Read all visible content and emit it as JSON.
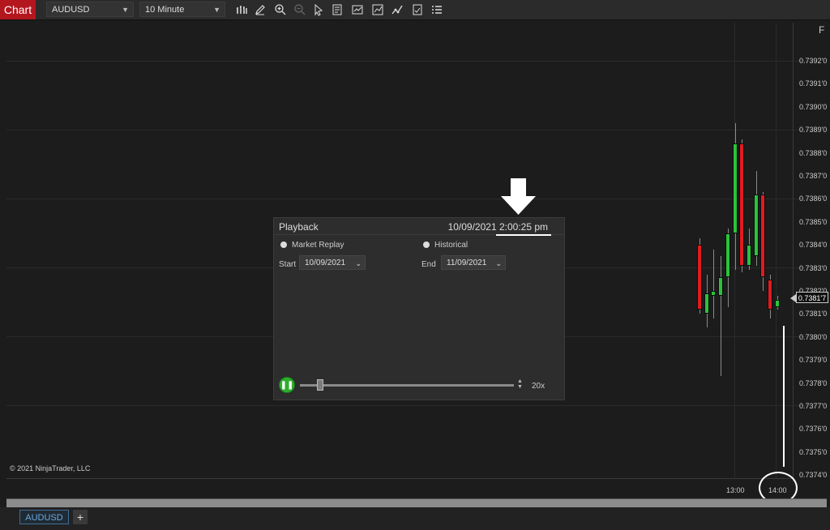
{
  "toolbar": {
    "chart_label": "Chart",
    "instrument": "AUDUSD",
    "interval": "10 Minute",
    "icons": [
      "bars-type-icon",
      "pencil-draw-icon",
      "zoom-in-icon",
      "zoom-out-icon",
      "pointer-icon",
      "data-box-icon",
      "chart-trader-icon",
      "indicators-icon",
      "strategies-icon",
      "templates-icon",
      "properties-list-icon"
    ]
  },
  "chart": {
    "price_labels": [
      "0.7392'0",
      "0.7391'0",
      "0.7390'0",
      "0.7389'0",
      "0.7388'0",
      "0.7387'0",
      "0.7386'0",
      "0.7385'0",
      "0.7384'0",
      "0.7383'0",
      "0.7382'0",
      "0.7381'0",
      "0.7380'0",
      "0.7379'0",
      "0.7378'0",
      "0.7377'0",
      "0.7376'0",
      "0.7375'0",
      "0.7374'0"
    ],
    "current_price": "0.7381'7",
    "time_labels": [
      "13:00",
      "14:00"
    ],
    "copyright": "© 2021 NinjaTrader, LLC",
    "f_button": "F",
    "candles": [
      {
        "dir": "down",
        "open": 0.7384,
        "close": 0.73812,
        "high": 0.73843,
        "low": 0.7381
      },
      {
        "dir": "up",
        "open": 0.7381,
        "close": 0.73819,
        "high": 0.73827,
        "low": 0.73804
      },
      {
        "dir": "up",
        "open": 0.73818,
        "close": 0.7382,
        "high": 0.73838,
        "low": 0.73808
      },
      {
        "dir": "up",
        "open": 0.73818,
        "close": 0.73826,
        "high": 0.73835,
        "low": 0.73783
      },
      {
        "dir": "up",
        "open": 0.73826,
        "close": 0.73845,
        "high": 0.73847,
        "low": 0.73813
      },
      {
        "dir": "up",
        "open": 0.73845,
        "close": 0.73884,
        "high": 0.73893,
        "low": 0.73829
      },
      {
        "dir": "down",
        "open": 0.73884,
        "close": 0.73831,
        "high": 0.73886,
        "low": 0.73828
      },
      {
        "dir": "up",
        "open": 0.73831,
        "close": 0.7384,
        "high": 0.73847,
        "low": 0.73829
      },
      {
        "dir": "up",
        "open": 0.73835,
        "close": 0.73862,
        "high": 0.73872,
        "low": 0.73831
      },
      {
        "dir": "down",
        "open": 0.73862,
        "close": 0.73826,
        "high": 0.73863,
        "low": 0.7382
      },
      {
        "dir": "down",
        "open": 0.73825,
        "close": 0.73812,
        "high": 0.73827,
        "low": 0.73808
      },
      {
        "dir": "up",
        "open": 0.73813,
        "close": 0.73816,
        "high": 0.73818,
        "low": 0.73812
      }
    ]
  },
  "playback": {
    "title": "Playback",
    "datetime": "10/09/2021 2:00:25 pm",
    "market_replay_label": "Market Replay",
    "historical_label": "Historical",
    "start_label": "Start",
    "start_value": "10/09/2021",
    "end_label": "End",
    "end_value": "11/09/2021",
    "speed": "20x"
  },
  "tabs": {
    "active": "AUDUSD",
    "add": "+"
  }
}
